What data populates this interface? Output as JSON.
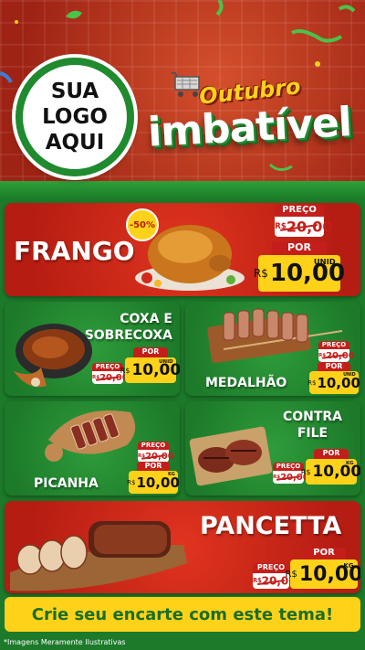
{
  "logo": {
    "line1": "SUA",
    "line2": "LOGO",
    "line3": "AQUI"
  },
  "brand": {
    "line1": "Outubro",
    "line2": "imbatível"
  },
  "products": [
    {
      "name": "FRANGO",
      "preco_label": "PREÇO",
      "old_currency": "R$",
      "old_price": "20,00",
      "por_label": "POR",
      "currency": "R$",
      "price": "10,00",
      "unit": "UNID",
      "badge": "-50%"
    },
    {
      "name_line1": "COXA E",
      "name_line2": "SOBRECOXA",
      "preco_label": "PREÇO",
      "old_currency": "R$",
      "old_price": "20,00",
      "por_label": "POR",
      "currency": "R$",
      "price": "10,00",
      "unit": "UNID"
    },
    {
      "name": "MEDALHÃO",
      "preco_label": "PREÇO",
      "old_currency": "R$",
      "old_price": "20,00",
      "por_label": "POR",
      "currency": "R$",
      "price": "10,00",
      "unit": "UNID"
    },
    {
      "name": "PICANHA",
      "preco_label": "PREÇO",
      "old_currency": "R$",
      "old_price": "20,00",
      "por_label": "POR",
      "currency": "R$",
      "price": "10,00",
      "unit": "KG"
    },
    {
      "name_line1": "CONTRA",
      "name_line2": "FILE",
      "preco_label": "PREÇO",
      "old_currency": "R$",
      "old_price": "20,00",
      "por_label": "POR",
      "currency": "R$",
      "price": "10,00",
      "unit": "KG"
    },
    {
      "name": "PANCETTA",
      "preco_label": "PREÇO",
      "old_currency": "R$",
      "old_price": "20,00",
      "por_label": "POR",
      "currency": "R$",
      "price": "10,00",
      "unit": "KG"
    }
  ],
  "footer": {
    "cta": "Crie seu encarte com este tema!",
    "disclaimer": "*Imagens Meramente Ilustrativas"
  },
  "colors": {
    "red": "#c41e1a",
    "green": "#1f8a2e",
    "yellow": "#ffd21a"
  }
}
